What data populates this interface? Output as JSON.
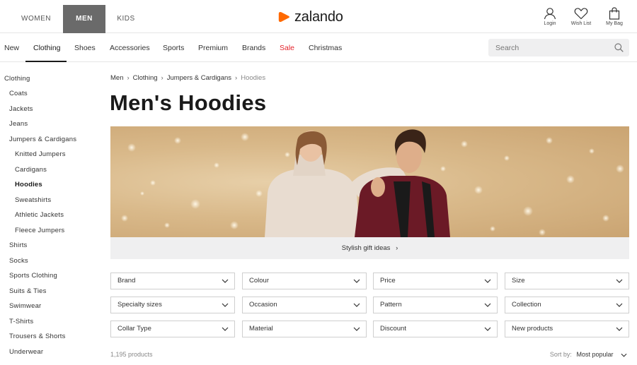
{
  "header": {
    "gender_tabs": [
      {
        "label": "WOMEN",
        "active": false
      },
      {
        "label": "MEN",
        "active": true
      },
      {
        "label": "KIDS",
        "active": false
      }
    ],
    "logo_text": "zalando",
    "brand_color": "#ff6900",
    "user_actions": [
      {
        "label": "Login",
        "icon": "person-icon"
      },
      {
        "label": "Wish List",
        "icon": "heart-icon"
      },
      {
        "label": "My Bag",
        "icon": "bag-icon"
      }
    ]
  },
  "catnav": {
    "items": [
      "New",
      "Clothing",
      "Shoes",
      "Accessories",
      "Sports",
      "Premium",
      "Brands",
      "Sale",
      "Christmas"
    ],
    "active": "Clothing",
    "sale_color": "#e4232b",
    "search_placeholder": "Search"
  },
  "sidebar": {
    "items": [
      {
        "label": "Clothing",
        "level": 0
      },
      {
        "label": "Coats",
        "level": 1
      },
      {
        "label": "Jackets",
        "level": 1
      },
      {
        "label": "Jeans",
        "level": 1
      },
      {
        "label": "Jumpers & Cardigans",
        "level": 1
      },
      {
        "label": "Knitted Jumpers",
        "level": 2
      },
      {
        "label": "Cardigans",
        "level": 2
      },
      {
        "label": "Hoodies",
        "level": 2,
        "active": true
      },
      {
        "label": "Sweatshirts",
        "level": 2
      },
      {
        "label": "Athletic Jackets",
        "level": 2
      },
      {
        "label": "Fleece Jumpers",
        "level": 2
      },
      {
        "label": "Shirts",
        "level": 1
      },
      {
        "label": "Socks",
        "level": 1
      },
      {
        "label": "Sports Clothing",
        "level": 1
      },
      {
        "label": "Suits & Ties",
        "level": 1
      },
      {
        "label": "Swimwear",
        "level": 1
      },
      {
        "label": "T-Shirts",
        "level": 1
      },
      {
        "label": "Trousers & Shorts",
        "level": 1
      },
      {
        "label": "Underwear",
        "level": 1
      }
    ]
  },
  "main": {
    "breadcrumb": [
      "Men",
      "Clothing",
      "Jumpers & Cardigans",
      "Hoodies"
    ],
    "title": "Men's Hoodies",
    "gift_link": "Stylish gift ideas",
    "filters": [
      "Brand",
      "Colour",
      "Price",
      "Size",
      "Specialty sizes",
      "Occasion",
      "Pattern",
      "Collection",
      "Collar Type",
      "Material",
      "Discount",
      "New products"
    ],
    "product_count": "1,195 products",
    "sort_label": "Sort by:",
    "sort_value": "Most popular"
  }
}
